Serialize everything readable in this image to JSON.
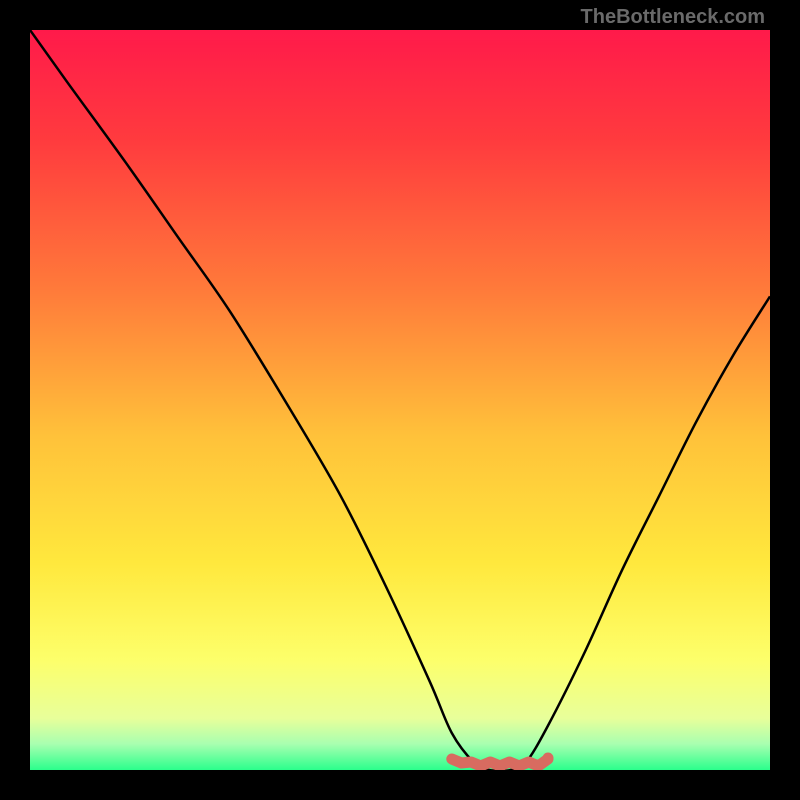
{
  "watermark": "TheBottleneck.com",
  "chart_data": {
    "type": "line",
    "title": "",
    "xlabel": "",
    "ylabel": "",
    "xlim": [
      0,
      100
    ],
    "ylim": [
      0,
      100
    ],
    "grid": false,
    "legend": false,
    "series": [
      {
        "name": "bottleneck-curve",
        "color": "#000000",
        "x": [
          0,
          5,
          13,
          20,
          27,
          35,
          42,
          48,
          54,
          57,
          60,
          62,
          65,
          67,
          70,
          75,
          80,
          85,
          90,
          95,
          100
        ],
        "y": [
          100,
          93,
          82,
          72,
          62,
          49,
          37,
          25,
          12,
          5,
          1,
          0,
          0,
          1,
          6,
          16,
          27,
          37,
          47,
          56,
          64
        ]
      }
    ],
    "highlight_band": {
      "name": "optimal-range",
      "color": "#d86b60",
      "x_start": 57,
      "x_end": 70,
      "y": 0
    },
    "background_gradient": [
      {
        "offset": 0.0,
        "color": "#ff1a4a"
      },
      {
        "offset": 0.15,
        "color": "#ff3b3e"
      },
      {
        "offset": 0.35,
        "color": "#ff7a3a"
      },
      {
        "offset": 0.55,
        "color": "#ffc23a"
      },
      {
        "offset": 0.72,
        "color": "#ffe83d"
      },
      {
        "offset": 0.85,
        "color": "#fdff6a"
      },
      {
        "offset": 0.93,
        "color": "#e8ff9a"
      },
      {
        "offset": 0.965,
        "color": "#a8ffb0"
      },
      {
        "offset": 1.0,
        "color": "#2bff8c"
      }
    ]
  }
}
